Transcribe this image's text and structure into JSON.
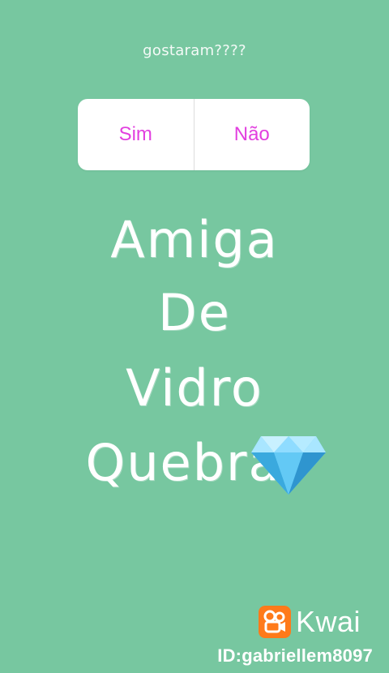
{
  "poll": {
    "question": "gostaram????",
    "options": [
      "Sim",
      "Não"
    ],
    "colors": {
      "option_text": "#e23fdf",
      "card": "#ffffff"
    }
  },
  "overlay_text": {
    "lines": [
      "Amiga",
      "De",
      "Vidro",
      "Quebra"
    ],
    "emoji": "gem-stone-icon"
  },
  "watermark": {
    "brand": "Kwai",
    "id": "ID:gabriellem8097",
    "brand_color": "#ff7a1a"
  },
  "background_color": "#77c7a0"
}
